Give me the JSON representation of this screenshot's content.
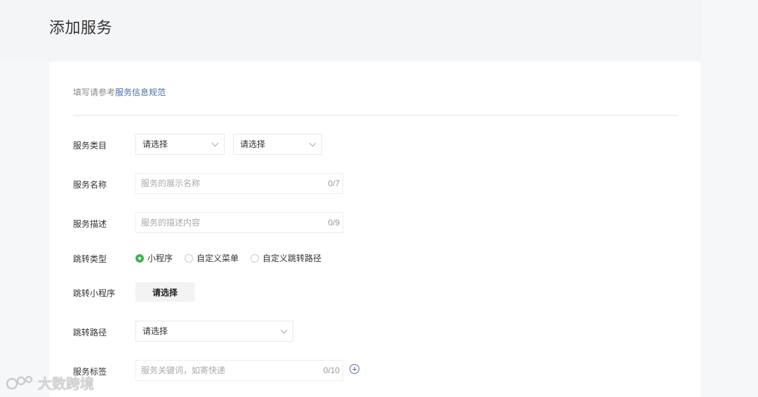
{
  "page": {
    "title": "添加服务"
  },
  "guide": {
    "prefix": "填写请参考",
    "link": "服务信息规范"
  },
  "category": {
    "label": "服务类目",
    "select1": "请选择",
    "select2": "请选择"
  },
  "name": {
    "label": "服务名称",
    "placeholder": "服务的展示名称",
    "counter": "0/7"
  },
  "description": {
    "label": "服务描述",
    "placeholder": "服务的描述内容",
    "counter": "0/9"
  },
  "jump_type": {
    "label": "跳转类型",
    "options": [
      "小程序",
      "自定义菜单",
      "自定义跳转路径"
    ],
    "selected": "小程序"
  },
  "mini_program": {
    "label": "跳转小程序",
    "button": "请选择"
  },
  "jump_path": {
    "label": "跳转路径",
    "select": "请选择"
  },
  "tags": {
    "label": "服务标签",
    "placeholder": "服务关键词，如寄快递",
    "counter": "0/10"
  },
  "watermark": {
    "text": "大数跨境"
  },
  "colors": {
    "accent_green": "#3eb44f",
    "link_blue": "#4a6fa5"
  }
}
